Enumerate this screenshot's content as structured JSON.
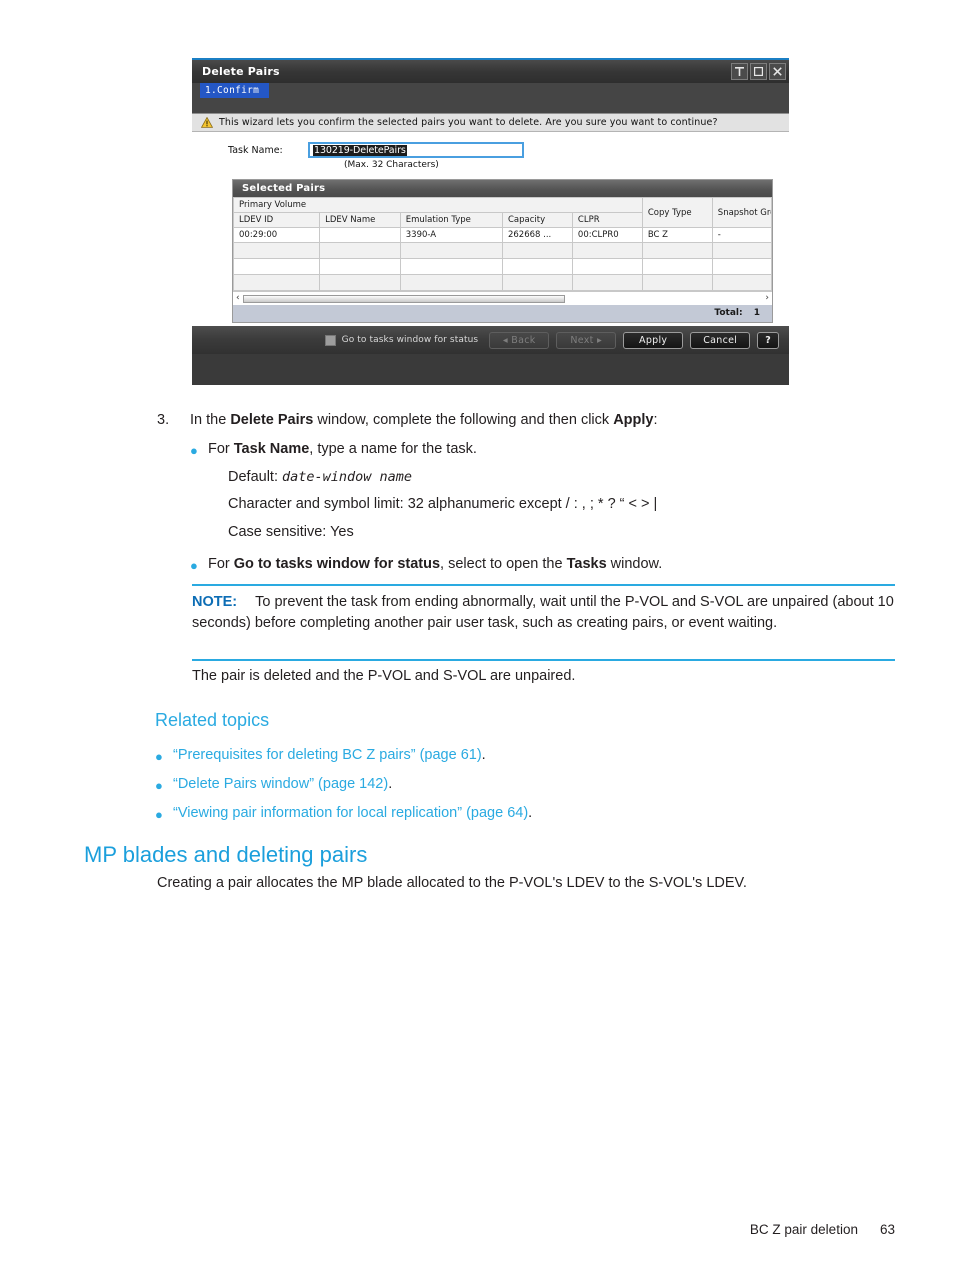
{
  "dialog": {
    "title": "Delete Pairs",
    "window_buttons": [
      {
        "name": "collapse-icon",
        "glyph": "T"
      },
      {
        "name": "maximize-icon",
        "glyph": "square"
      },
      {
        "name": "close-icon",
        "glyph": "X"
      }
    ],
    "step_tab": "1.Confirm",
    "notice": "This wizard lets you confirm the selected pairs you want to delete. Are you sure you want to continue?",
    "task_name_label": "Task Name:",
    "task_name_value": "130219-DeletePairs",
    "task_name_hint": "(Max. 32 Characters)",
    "table": {
      "panel_title": "Selected Pairs",
      "group_header": "Primary Volume",
      "columns": [
        "LDEV ID",
        "LDEV Name",
        "Emulation Type",
        "Capacity",
        "CLPR",
        "Copy Type",
        "Snapshot Group"
      ],
      "rows": [
        [
          "00:29:00",
          "",
          "3390-A",
          "262668 ...",
          "00:CLPR0",
          "BC Z",
          "-"
        ]
      ],
      "empty_row_count": 3,
      "total_label": "Total:",
      "total_value": "1"
    },
    "footer": {
      "checkbox_label": "Go to tasks window for status",
      "checkbox_checked": false,
      "back_label": "Back",
      "back_enabled": false,
      "next_label": "Next",
      "next_enabled": false,
      "apply_label": "Apply",
      "cancel_label": "Cancel",
      "help_label": "?"
    }
  },
  "doc": {
    "step_number": "3.",
    "step_prefix": "In the ",
    "step_bold1": "Delete Pairs",
    "step_mid": " window, complete the following and then click ",
    "step_bold2": "Apply",
    "step_suffix": ":",
    "bullet1_prefix": "For ",
    "bullet1_bold": "Task Name",
    "bullet1_suffix": ", type a name for the task.",
    "default_label": "Default: ",
    "default_value": "date-window name",
    "char_limit": "Character and symbol limit: 32 alphanumeric except / : , ; * ? “ < > |",
    "case_sensitive": "Case sensitive: Yes",
    "bullet2_prefix": "For ",
    "bullet2_bold1": "Go to tasks window for status",
    "bullet2_mid": ", select to open the ",
    "bullet2_bold2": "Tasks",
    "bullet2_suffix": " window.",
    "note_label": "NOTE:",
    "note_text": "To prevent the task from ending abnormally, wait until the P-VOL and S-VOL are unpaired (about 10 seconds) before completing another pair user task, such as creating pairs, or event waiting.",
    "after_note": "The pair is deleted and the P-VOL and S-VOL are unpaired.",
    "related_heading": "Related topics",
    "related_links": [
      {
        "text": "“Prerequisites for deleting BC Z pairs” (page 61)",
        "tail": "."
      },
      {
        "text": "“Delete Pairs window” (page 142)",
        "tail": "."
      },
      {
        "text": "“Viewing pair information for local replication” (page 64)",
        "tail": "."
      }
    ],
    "section_heading": "MP blades and deleting pairs",
    "section_para": "Creating a pair allocates the MP blade allocated to the P-VOL's LDEV to the S-VOL's LDEV.",
    "footer_title": "BC Z pair deletion",
    "footer_page": "63"
  },
  "colors": {
    "accent_blue": "#2aaae1",
    "heading_blue": "#1b9fdc",
    "note_blue": "#0c6db5",
    "step_tab_blue": "#2457c5",
    "input_focus": "#4a9fe0"
  }
}
